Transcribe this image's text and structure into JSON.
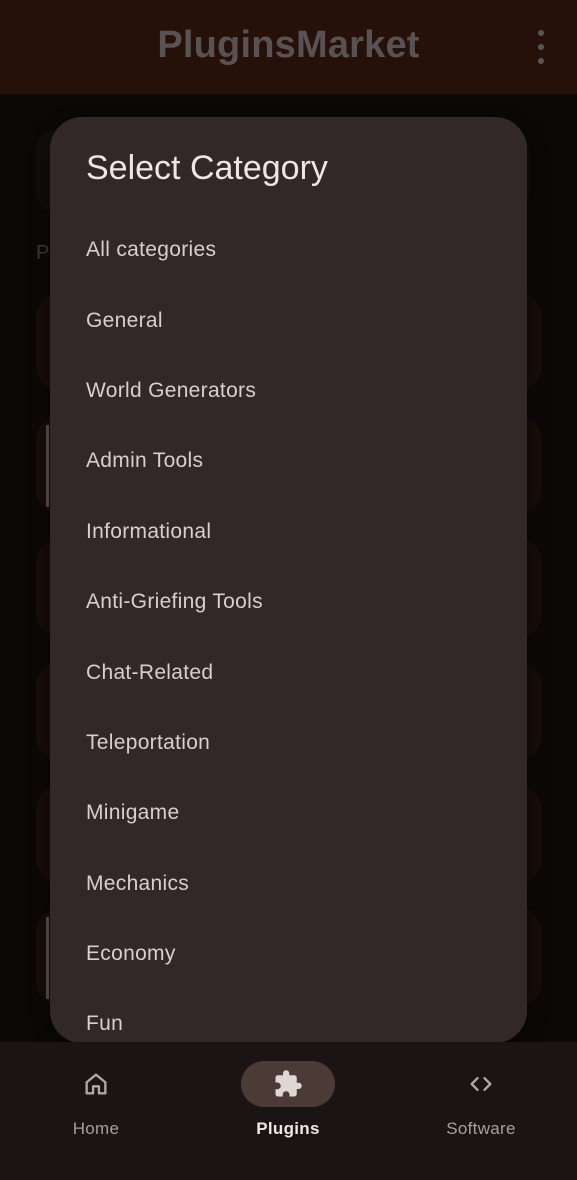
{
  "app": {
    "title": "PluginsMarket"
  },
  "background": {
    "section_initial": "P"
  },
  "dialog": {
    "title": "Select Category",
    "options": [
      "All categories",
      "General",
      "World Generators",
      "Admin Tools",
      "Informational",
      "Anti-Griefing Tools",
      "Chat-Related",
      "Teleportation",
      "Minigame",
      "Mechanics",
      "Economy",
      "Fun"
    ]
  },
  "bottom_nav": {
    "items": [
      {
        "label": "Home",
        "icon": "home-icon",
        "active": false
      },
      {
        "label": "Plugins",
        "icon": "puzzle-icon",
        "active": true
      },
      {
        "label": "Software",
        "icon": "code-icon",
        "active": false
      }
    ]
  },
  "colors": {
    "appbar": "#3a1a10",
    "dialog": "#312827",
    "active_pill": "#4b3a36"
  }
}
